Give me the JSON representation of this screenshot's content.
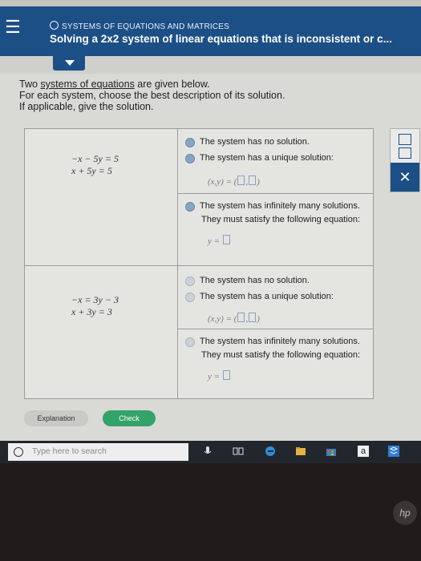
{
  "header": {
    "topic": "SYSTEMS OF EQUATIONS AND MATRICES",
    "title": "Solving a 2x2 system of linear equations that is inconsistent or c..."
  },
  "intro": {
    "line1_prefix": "Two ",
    "line1_link": "systems of equations",
    "line1_suffix": " are given below.",
    "line2": "For each system, choose the best description of its solution.",
    "line3": "If applicable, give the solution."
  },
  "systems": [
    {
      "eq1": "−x − 5y = 5",
      "eq2": "x + 5y = 5",
      "opt_no_solution": "The system has no solution.",
      "opt_unique": "The system has a unique solution:",
      "unique_answer_prefix": "(x,y) = (",
      "unique_answer_suffix": ")",
      "opt_infinite_line1": "The system has infinitely many solutions.",
      "opt_infinite_line2": "They must satisfy the following equation:",
      "infinite_answer_prefix": "y ="
    },
    {
      "eq1": "−x = 3y − 3",
      "eq2": "x + 3y = 3",
      "opt_no_solution": "The system has no solution.",
      "opt_unique": "The system has a unique solution:",
      "unique_answer_prefix": "(x,y) = (",
      "unique_answer_suffix": ")",
      "opt_infinite_line1": "The system has infinitely many solutions.",
      "opt_infinite_line2": "They must satisfy the following equation:",
      "infinite_answer_prefix": "y ="
    }
  ],
  "buttons": {
    "explanation": "Explanation",
    "check": "Check"
  },
  "taskbar": {
    "search_placeholder": "Type here to search",
    "amazon_letter": "a"
  },
  "bezel": {
    "logo": "hp"
  },
  "colors": {
    "header_bg": "#1c4f86",
    "check_green": "#33a36a",
    "taskbar_bg": "#22272d"
  }
}
